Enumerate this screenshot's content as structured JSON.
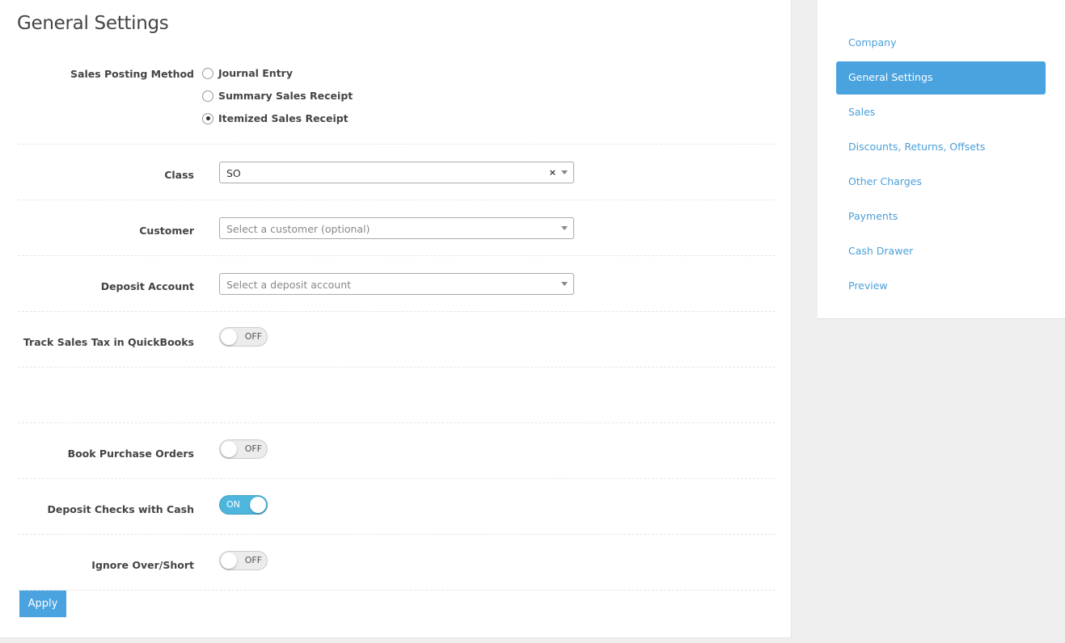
{
  "page": {
    "title": "General Settings"
  },
  "sales_posting": {
    "label": "Sales Posting Method",
    "options": [
      {
        "label": "Journal Entry",
        "selected": false
      },
      {
        "label": "Summary Sales Receipt",
        "selected": false
      },
      {
        "label": "Itemized Sales Receipt",
        "selected": true
      }
    ]
  },
  "class_field": {
    "label": "Class",
    "value": "SO",
    "clear_symbol": "×"
  },
  "customer_field": {
    "label": "Customer",
    "placeholder": "Select a customer (optional)"
  },
  "deposit_field": {
    "label": "Deposit Account",
    "placeholder": "Select a deposit account"
  },
  "toggles": {
    "track_tax": {
      "label": "Track Sales Tax in QuickBooks",
      "state": "OFF"
    },
    "book_po": {
      "label": "Book Purchase Orders",
      "state": "OFF"
    },
    "deposit_checks": {
      "label": "Deposit Checks with Cash",
      "state": "ON"
    },
    "ignore_over_short": {
      "label": "Ignore Over/Short",
      "state": "OFF"
    }
  },
  "apply_label": "Apply",
  "sidebar": {
    "items": [
      {
        "label": "Company",
        "active": false
      },
      {
        "label": "General Settings",
        "active": true
      },
      {
        "label": "Sales",
        "active": false
      },
      {
        "label": "Discounts, Returns, Offsets",
        "active": false
      },
      {
        "label": "Other Charges",
        "active": false
      },
      {
        "label": "Payments",
        "active": false
      },
      {
        "label": "Cash Drawer",
        "active": false
      },
      {
        "label": "Preview",
        "active": false
      }
    ]
  },
  "colors": {
    "accent": "#4aa3df",
    "toggle_on": "#4eb6dd",
    "link": "#4a9fd8"
  }
}
